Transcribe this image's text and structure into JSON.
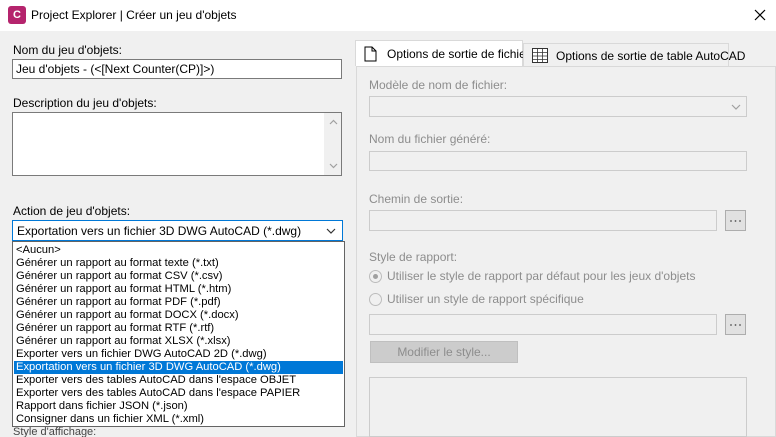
{
  "window": {
    "title": "Project Explorer | Créer un jeu d'objets",
    "app_icon_letter": "C"
  },
  "left": {
    "name_label": "Nom du jeu d'objets:",
    "name_value": "Jeu d'objets - (<[Next Counter(CP)]>)",
    "description_label": "Description du jeu d'objets:",
    "description_value": "",
    "action_label": "Action de jeu d'objets:",
    "action_selected": "Exportation vers un fichier 3D DWG AutoCAD (*.dwg)",
    "action_options": [
      "<Aucun>",
      "Générer un rapport au format texte (*.txt)",
      "Générer un rapport au format CSV (*.csv)",
      "Générer un rapport au format HTML (*.htm)",
      "Générer un rapport au format PDF (*.pdf)",
      "Générer un rapport au format DOCX (*.docx)",
      "Générer un rapport au format RTF (*.rtf)",
      "Générer un rapport au format XLSX (*.xlsx)",
      "Exporter vers un fichier DWG AutoCAD 2D (*.dwg)",
      "Exportation vers un fichier 3D DWG AutoCAD (*.dwg)",
      "Exporter vers des tables AutoCAD dans l'espace OBJET",
      "Exporter vers des tables AutoCAD dans l'espace PAPIER",
      "Rapport dans fichier JSON (*.json)",
      "Consigner dans un fichier XML (*.xml)"
    ],
    "selected_index": 9,
    "hidden_label_fragment": "Style d'affichage:"
  },
  "tabs": [
    {
      "label": "Options de sortie de fichier",
      "icon": "document-icon",
      "active": true
    },
    {
      "label": "Options de sortie de table AutoCAD",
      "icon": "table-icon",
      "active": false
    }
  ],
  "file_options": {
    "template_label": "Modèle de nom de fichier:",
    "template_value": "",
    "generated_label": "Nom du fichier généré:",
    "generated_value": "",
    "output_path_label": "Chemin de sortie:",
    "output_path_value": "",
    "browse_glyph": "...",
    "report_style_label": "Style de rapport:",
    "radio_default": "Utiliser le style de rapport par défaut pour les jeux d'objets",
    "radio_specific": "Utiliser un style de rapport spécifique",
    "specific_style_value": "",
    "modify_button": "Modifier le style..."
  },
  "colors": {
    "accent": "#0078d7",
    "app_icon": "#b5246d",
    "disabled_text": "#8d8d8d"
  }
}
